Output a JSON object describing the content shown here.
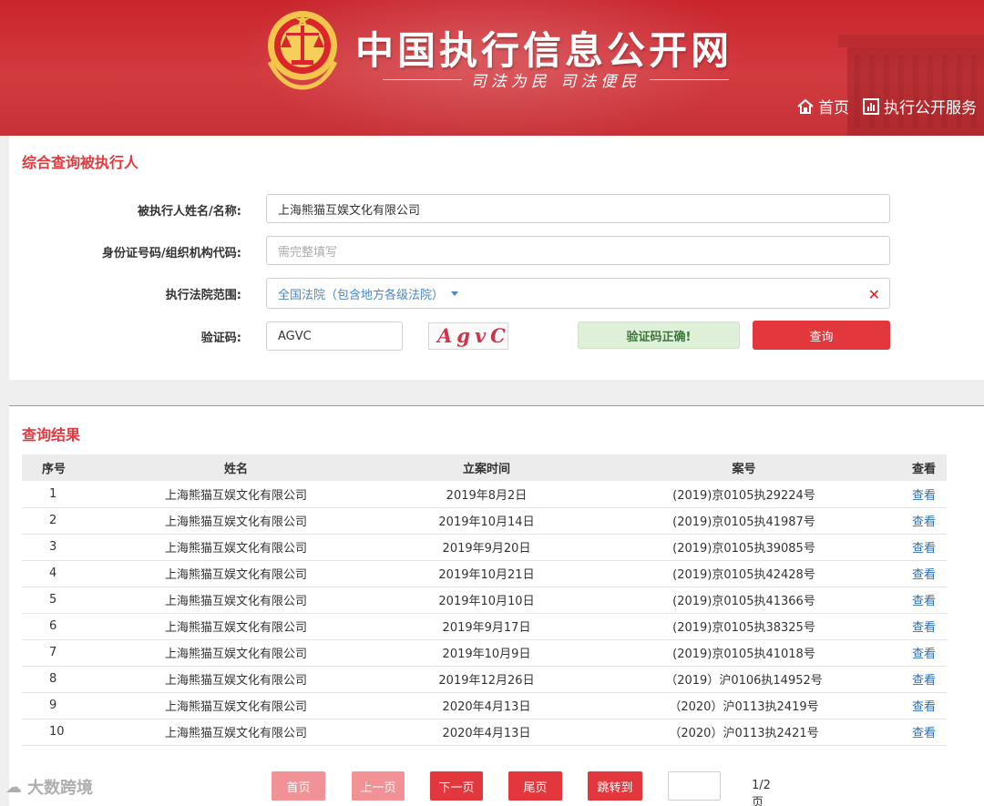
{
  "header": {
    "site_title": "中国执行信息公开网",
    "slogan": "司法为民  司法便民",
    "nav": [
      {
        "label": "首页",
        "icon": "home-icon"
      },
      {
        "label": "执行公开服务",
        "icon": "chart-icon"
      }
    ]
  },
  "search": {
    "title": "综合查询被执行人",
    "name_label": "被执行人姓名/名称:",
    "name_value": "上海熊猫互娱文化有限公司",
    "id_label": "身份证号码/组织机构代码:",
    "id_placeholder": "需完整填写",
    "court_label": "执行法院范围:",
    "court_value": "全国法院（包含地方各级法院）",
    "captcha_label": "验证码:",
    "captcha_value": "AGVC",
    "captcha_image_text": "AgvC",
    "verify_message": "验证码正确!",
    "query_button": "查询"
  },
  "results": {
    "title": "查询结果",
    "columns": [
      "序号",
      "姓名",
      "立案时间",
      "案号",
      "查看"
    ],
    "rows": [
      {
        "seq": "1",
        "name": "上海熊猫互娱文化有限公司",
        "date": "2019年8月2日",
        "case": "(2019)京0105执29224号",
        "view": "查看"
      },
      {
        "seq": "2",
        "name": "上海熊猫互娱文化有限公司",
        "date": "2019年10月14日",
        "case": "(2019)京0105执41987号",
        "view": "查看"
      },
      {
        "seq": "3",
        "name": "上海熊猫互娱文化有限公司",
        "date": "2019年9月20日",
        "case": "(2019)京0105执39085号",
        "view": "查看"
      },
      {
        "seq": "4",
        "name": "上海熊猫互娱文化有限公司",
        "date": "2019年10月21日",
        "case": "(2019)京0105执42428号",
        "view": "查看"
      },
      {
        "seq": "5",
        "name": "上海熊猫互娱文化有限公司",
        "date": "2019年10月10日",
        "case": "(2019)京0105执41366号",
        "view": "查看"
      },
      {
        "seq": "6",
        "name": "上海熊猫互娱文化有限公司",
        "date": "2019年9月17日",
        "case": "(2019)京0105执38325号",
        "view": "查看"
      },
      {
        "seq": "7",
        "name": "上海熊猫互娱文化有限公司",
        "date": "2019年10月9日",
        "case": "(2019)京0105执41018号",
        "view": "查看"
      },
      {
        "seq": "8",
        "name": "上海熊猫互娱文化有限公司",
        "date": "2019年12月26日",
        "case": "（2019）沪0106执14952号",
        "view": "查看"
      },
      {
        "seq": "9",
        "name": "上海熊猫互娱文化有限公司",
        "date": "2020年4月13日",
        "case": "（2020）沪0113执2419号",
        "view": "查看"
      },
      {
        "seq": "10",
        "name": "上海熊猫互娱文化有限公司",
        "date": "2020年4月13日",
        "case": "（2020）沪0113执2421号",
        "view": "查看"
      }
    ]
  },
  "pager": {
    "first": "首页",
    "prev": "上一页",
    "next": "下一页",
    "last": "尾页",
    "jump": "跳转到",
    "page_info": "1/2页"
  },
  "watermark": "大数跨境",
  "colors": {
    "brand_red": "#e2373d",
    "header_red": "#c9252d",
    "link_blue": "#2d6db5",
    "success_green": "#dff0d8"
  }
}
